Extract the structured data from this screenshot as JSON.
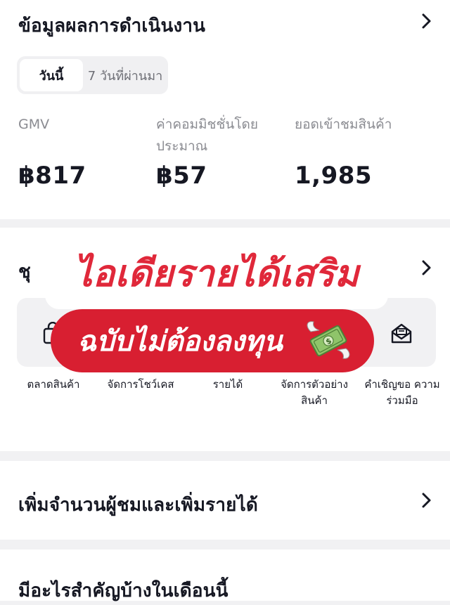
{
  "performance": {
    "title": "ข้อมูลผลการดำเนินงาน",
    "tabs": [
      "วันนี้",
      "7 วันที่ผ่านมา"
    ],
    "metrics": [
      {
        "label": "GMV",
        "value": "฿817"
      },
      {
        "label": "ค่าคอมมิชชั่นโดย ประมาณ",
        "value": "฿57"
      },
      {
        "label": "ยอดเข้าชมสินค้า",
        "value": "1,985"
      }
    ]
  },
  "tools": {
    "title_partial": "ชุ",
    "items": [
      {
        "label": "ตลาดสินค้า",
        "icon": "shop-icon"
      },
      {
        "label": "จัดการโชว์เคส",
        "icon": "showcase-icon"
      },
      {
        "label": "รายได้",
        "icon": "income-icon"
      },
      {
        "label": "จัดการตัวอย่าง สินค้า",
        "icon": "sample-icon"
      },
      {
        "label": "คำเชิญขอ ความร่วมมือ",
        "icon": "invitation-icon"
      }
    ]
  },
  "grow": {
    "title": "เพิ่มจำนวนผู้ชมและเพิ่มรายได้"
  },
  "month": {
    "title": "มีอะไรสำคัญบ้างในเดือนนี้"
  },
  "overlay": {
    "headline": "ไอเดียรายได้เสริม",
    "subline": "ฉบับไม่ต้องลงทุน",
    "sticker": "money-with-wings-icon",
    "colors": {
      "headline": "#e0283a",
      "pill": "#d81f31"
    }
  }
}
